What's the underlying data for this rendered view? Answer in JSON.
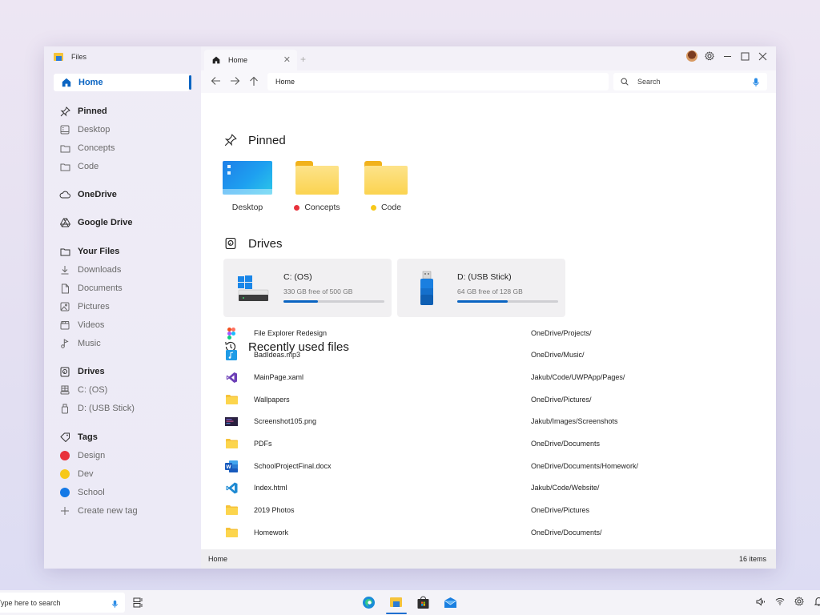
{
  "app": {
    "title": "Files",
    "accent_color": "#0a64c2"
  },
  "sidebar": {
    "home": {
      "label": "Home",
      "icon": "home-icon",
      "selected": true
    },
    "sections": [
      {
        "label": "Pinned",
        "icon": "pin-icon",
        "header": true
      },
      {
        "label": "Desktop",
        "icon": "desktop-icon"
      },
      {
        "label": "Concepts",
        "icon": "folder-icon"
      },
      {
        "label": "Code",
        "icon": "folder-icon"
      },
      {
        "label": "OneDrive",
        "icon": "cloud-icon",
        "header": true
      },
      {
        "label": "Google Drive",
        "icon": "google-drive-icon",
        "header": true
      },
      {
        "label": "Your Files",
        "icon": "folder-icon",
        "header": true
      },
      {
        "label": "Downloads",
        "icon": "download-icon"
      },
      {
        "label": "Documents",
        "icon": "document-icon"
      },
      {
        "label": "Pictures",
        "icon": "picture-icon"
      },
      {
        "label": "Videos",
        "icon": "video-icon"
      },
      {
        "label": "Music",
        "icon": "music-icon"
      },
      {
        "label": "Drives",
        "icon": "drive-icon",
        "header": true
      },
      {
        "label": "C: (OS)",
        "icon": "hard-drive-icon"
      },
      {
        "label": "D: (USB Stick)",
        "icon": "usb-icon"
      },
      {
        "label": "Tags",
        "icon": "tag-icon",
        "header": true
      },
      {
        "label": "Design",
        "color": "#e8323c"
      },
      {
        "label": "Dev",
        "color": "#f7c81a"
      },
      {
        "label": "School",
        "color": "#1479e6"
      },
      {
        "label": "Create new tag",
        "icon": "plus-icon"
      }
    ]
  },
  "tabs": [
    {
      "label": "Home",
      "icon": "home-icon",
      "active": true
    }
  ],
  "toolbar": {
    "address": "Home",
    "search_placeholder": "Search"
  },
  "main": {
    "pinned": {
      "title": "Pinned",
      "items": [
        {
          "label": "Desktop",
          "type": "desktop"
        },
        {
          "label": "Concepts",
          "type": "folder",
          "tag_color": "#e8323c"
        },
        {
          "label": "Code",
          "type": "folder",
          "tag_color": "#f7c81a"
        }
      ]
    },
    "drives": {
      "title": "Drives",
      "items": [
        {
          "name": "C: (OS)",
          "free_text": "330 GB free of 500 GB",
          "used_fraction": 0.34,
          "type": "os"
        },
        {
          "name": "D: (USB Stick)",
          "free_text": "64 GB free of 128 GB",
          "used_fraction": 0.5,
          "type": "usb"
        }
      ]
    },
    "recent": {
      "title": "Recently used files",
      "items": [
        {
          "name": "File Explorer Redesign",
          "path": "OneDrive/Projects/",
          "icon": "figma-icon"
        },
        {
          "name": "BadIdeas.mp3",
          "path": "OneDrive/Music/",
          "icon": "music-file-icon"
        },
        {
          "name": "MainPage.xaml",
          "path": "Jakub/Code/UWPApp/Pages/",
          "icon": "visual-studio-icon"
        },
        {
          "name": "Wallpapers",
          "path": "OneDrive/Pictures/",
          "icon": "folder-icon"
        },
        {
          "name": "Screenshot105.png",
          "path": "Jakub/Images/Screenshots",
          "icon": "image-file-icon"
        },
        {
          "name": "PDFs",
          "path": "OneDrive/Documents",
          "icon": "folder-icon"
        },
        {
          "name": "SchoolProjectFinal.docx",
          "path": "OneDrive/Documents/Homework/",
          "icon": "word-icon"
        },
        {
          "name": "Index.html",
          "path": "Jakub/Code/Website/",
          "icon": "vscode-icon"
        },
        {
          "name": "2019 Photos",
          "path": "OneDrive/Pictures",
          "icon": "folder-icon"
        },
        {
          "name": "Homework",
          "path": "OneDrive/Documents/",
          "icon": "folder-icon"
        }
      ]
    }
  },
  "statusbar": {
    "location": "Home",
    "count": "16 items"
  },
  "taskbar": {
    "search_placeholder": "Type here to search",
    "apps": [
      {
        "name": "edge",
        "active": false
      },
      {
        "name": "files",
        "active": true
      },
      {
        "name": "store",
        "active": false
      },
      {
        "name": "mail",
        "active": false
      }
    ]
  }
}
